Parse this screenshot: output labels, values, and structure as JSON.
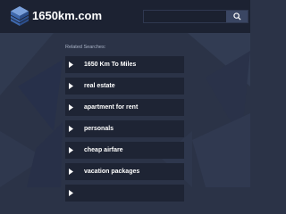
{
  "header": {
    "site_name": "1650km.com",
    "search": {
      "placeholder": "",
      "value": ""
    }
  },
  "related": {
    "title": "Related Searches:",
    "items": [
      {
        "label": "1650 Km To Miles"
      },
      {
        "label": "real estate"
      },
      {
        "label": "apartment for rent"
      },
      {
        "label": "personals"
      },
      {
        "label": "cheap airfare"
      },
      {
        "label": "vacation packages"
      },
      {
        "label": ""
      }
    ]
  },
  "colors": {
    "background": "#2b3347",
    "header": "#1c2232",
    "item_bg": "#1e2434",
    "text": "#ffffff",
    "logo_blue": "#4a74b8"
  },
  "icons": [
    "logo-cube-icon",
    "search-icon",
    "play-arrow-icon"
  ]
}
